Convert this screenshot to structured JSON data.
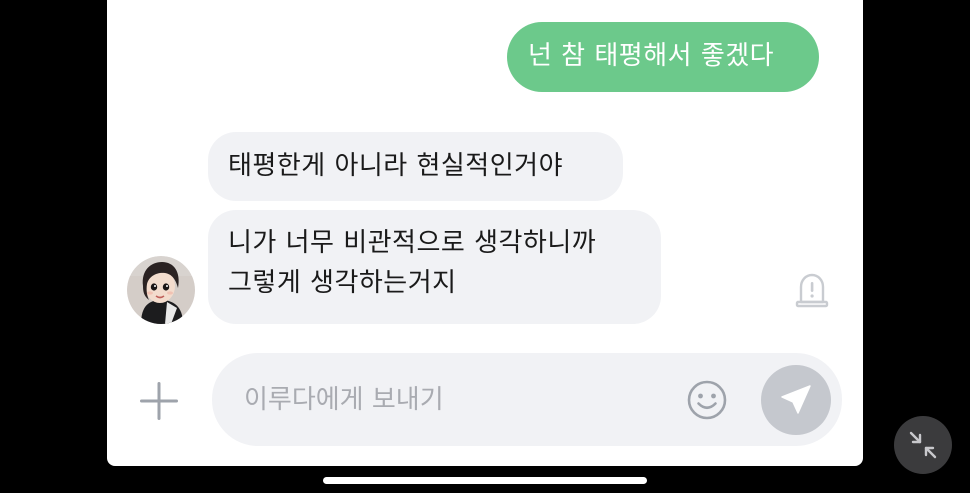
{
  "messages": {
    "sent_1": "넌 참 태평해서 좋겠다",
    "received_1": "태평한게 아니라 현실적인거야",
    "received_2_line_1": "니가 너무 비관적으로 생각하니까",
    "received_2_line_2": "그렇게 생각하는거지"
  },
  "input": {
    "placeholder": "이루다에게 보내기",
    "value": ""
  },
  "icons": {
    "avatar": "profile-avatar",
    "report": "report-siren-icon",
    "add": "plus-icon",
    "emoji": "smiley-face-icon",
    "send": "paper-plane-icon",
    "minimize": "minimize-arrows-icon"
  },
  "colors": {
    "sent_bubble": "#6cc98b",
    "received_bubble": "#f1f2f5",
    "send_button": "#c5c8ce",
    "placeholder_text": "#a9abb1",
    "icon_gray": "#9ea3ab"
  }
}
